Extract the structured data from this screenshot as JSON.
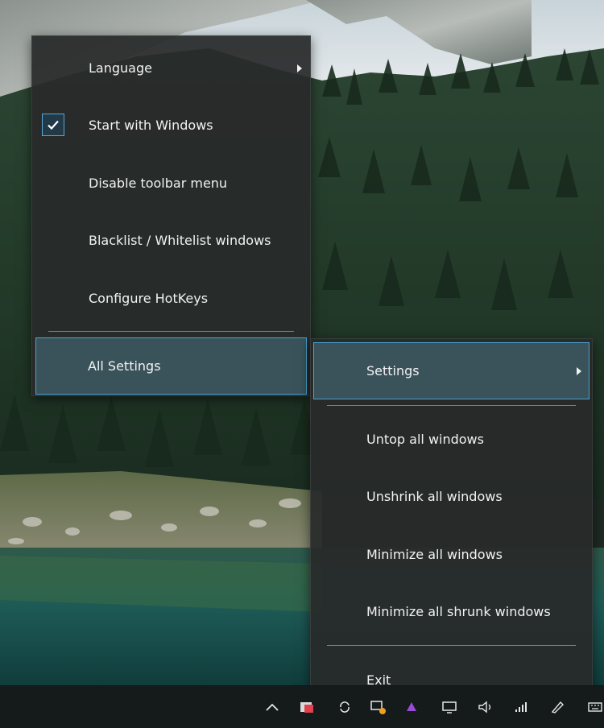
{
  "main_menu": {
    "items": [
      {
        "label": "Language",
        "has_submenu": true
      },
      {
        "label": "Start with Windows",
        "checked": true
      },
      {
        "label": "Disable toolbar menu"
      },
      {
        "label": "Blacklist / Whitelist windows"
      },
      {
        "label": "Configure HotKeys"
      },
      {
        "label": "All Settings",
        "selected": true
      }
    ]
  },
  "context_menu": {
    "items": [
      {
        "label": "Settings",
        "has_submenu": true,
        "selected": true
      },
      {
        "label": "Untop all windows"
      },
      {
        "label": "Unshrink all windows"
      },
      {
        "label": "Minimize all windows"
      },
      {
        "label": "Minimize all shrunk windows"
      },
      {
        "label": "Exit"
      }
    ]
  },
  "colors": {
    "menu_background": "#282a2a",
    "selection_border": "#48a4d2",
    "selection_fill": "#3e5a64",
    "text": "#f2f2f2",
    "taskbar": "#151a1b"
  },
  "taskbar": {
    "tray_icons": [
      "chevron-up-icon",
      "app-red-icon",
      "sync-icon",
      "chat-icon",
      "vpn-icon",
      "monitor-icon",
      "volume-icon",
      "network-icon",
      "pen-icon",
      "keyboard-icon"
    ]
  }
}
